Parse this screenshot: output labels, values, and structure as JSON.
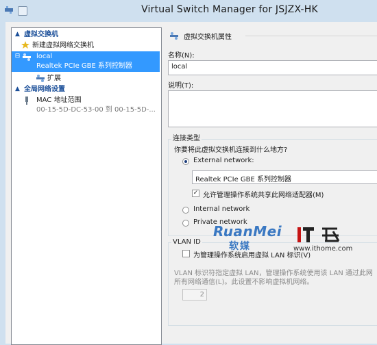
{
  "window": {
    "title": "Virtual Switch Manager for JSJZX-HK"
  },
  "tree": {
    "virtual_switches_header": "虚拟交换机",
    "new_switch": "新建虚拟网络交换机",
    "selected_switch": {
      "name": "local",
      "adapter": "Realtek PCIe GBE 系列控制器"
    },
    "extensions": "扩展",
    "global_header": "全局网络设置",
    "mac_range": {
      "label": "MAC 地址范围",
      "value": "00-15-5D-DC-53-00 到 00-15-5D-..."
    }
  },
  "properties": {
    "section_title": "虚拟交换机属性",
    "name_label": "名称(N):",
    "name_value": "local",
    "notes_label": "说明(T):",
    "notes_value": "",
    "connection_type": {
      "title": "连接类型",
      "question": "你要将此虚拟交换机连接到什么地方?",
      "external_label": "External network:",
      "adapter_selected": "Realtek PCIe GBE 系列控制器",
      "allow_mgmt_label": "允许管理操作系统共享此网络适配器(M)",
      "allow_mgmt_checked": true,
      "internal_label": "Internal network",
      "private_label": "Private network",
      "selected": "external"
    },
    "vlan": {
      "title": "VLAN ID",
      "enable_label": "为管理操作系统启用虚拟 LAN 标识(V)",
      "enable_checked": false,
      "description_line1": "VLAN 标识符指定虚拟 LAN，管理操作系统使用该 LAN 通过此网",
      "description_line2": "所有网络通信(L)。此设置不影响虚拟机网络。",
      "value": "2"
    }
  },
  "watermarks": {
    "ruanmei_latin": "RuanMei",
    "ruanmei_cn": "软媒",
    "ithome_logo": "IT之家",
    "ithome_url": "www.ithome.com"
  },
  "colors": {
    "titlebar": "#cfe0ef",
    "selection": "#3399ff",
    "header_text": "#1b4f99"
  }
}
